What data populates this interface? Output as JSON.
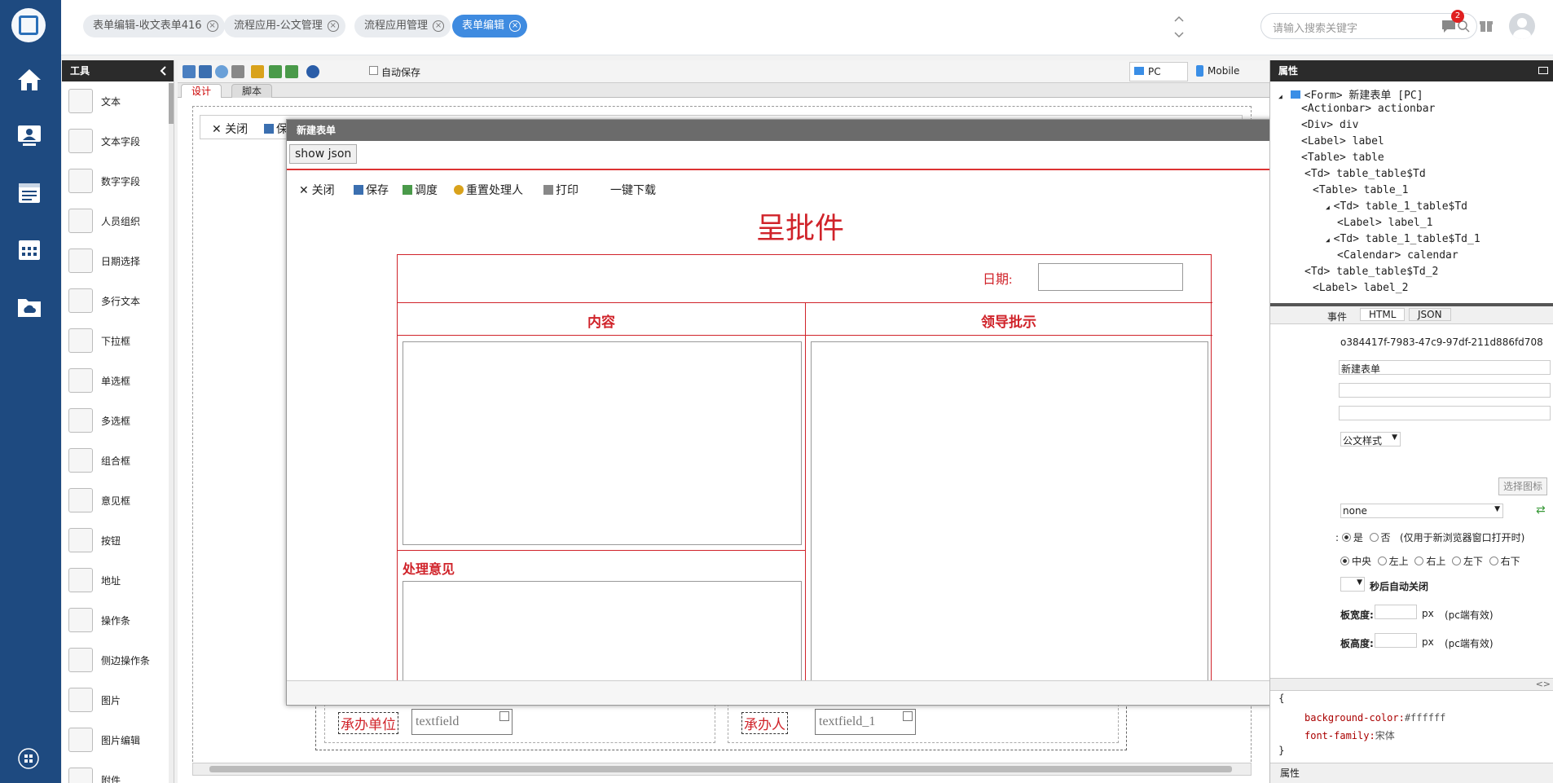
{
  "top_tabs": [
    {
      "label": "表单编辑-收文表单416",
      "active": false
    },
    {
      "label": "流程应用-公文管理",
      "active": false
    },
    {
      "label": "流程应用管理",
      "active": false
    },
    {
      "label": "表单编辑",
      "active": true
    }
  ],
  "search": {
    "placeholder": "请输入搜索关键字"
  },
  "notifications": {
    "count": "2"
  },
  "tools": {
    "title": "工具",
    "items": [
      {
        "label": "文本",
        "icon": "text-icon"
      },
      {
        "label": "文本字段",
        "icon": "textfield-icon"
      },
      {
        "label": "数字字段",
        "icon": "number-field-icon"
      },
      {
        "label": "人员组织",
        "icon": "person-org-icon"
      },
      {
        "label": "日期选择",
        "icon": "calendar-icon"
      },
      {
        "label": "多行文本",
        "icon": "textarea-icon"
      },
      {
        "label": "下拉框",
        "icon": "dropdown-icon"
      },
      {
        "label": "单选框",
        "icon": "radio-icon"
      },
      {
        "label": "多选框",
        "icon": "checkbox-icon"
      },
      {
        "label": "组合框",
        "icon": "combobox-icon"
      },
      {
        "label": "意见框",
        "icon": "opinion-icon"
      },
      {
        "label": "按钮",
        "icon": "hand-pointer-icon"
      },
      {
        "label": "地址",
        "icon": "location-pin-icon"
      },
      {
        "label": "操作条",
        "icon": "actionbar-icon"
      },
      {
        "label": "侧边操作条",
        "icon": "side-actionbar-icon"
      },
      {
        "label": "图片",
        "icon": "image-icon"
      },
      {
        "label": "图片编辑",
        "icon": "image-edit-icon"
      },
      {
        "label": "附件",
        "icon": "attachment-icon"
      }
    ]
  },
  "design_toolbar": {
    "autosave_label": "自动保存",
    "device_pc": "PC",
    "device_mobile": "Mobile"
  },
  "mode_tabs": [
    {
      "label": "设计",
      "active": true
    },
    {
      "label": "脚本",
      "active": false
    }
  ],
  "canvas_bg": {
    "close_label": "关闭",
    "save_label": "保存",
    "unit_label": "承办单位",
    "unit_field": "textfield",
    "person_label": "承办人",
    "person_field": "textfield_1"
  },
  "modal": {
    "title": "新建表单",
    "show_json": "show json",
    "actions": [
      "关闭",
      "保存",
      "调度",
      "重置处理人",
      "打印",
      "一键下载"
    ],
    "form_title": "呈批件",
    "date_label": "日期:",
    "col_content": "内容",
    "col_leader": "领导批示",
    "opinion_label": "处理意见"
  },
  "properties": {
    "title": "属性",
    "tree": [
      "<Form> 新建表单 [PC]",
      "<Actionbar> actionbar",
      "<Div> div",
      "<Label> label",
      "<Table> table",
      "<Td> table_table$Td",
      "<Table> table_1",
      "<Td> table_1_table$Td",
      "<Label> label_1",
      "<Td> table_1_table$Td_1",
      "<Calendar> calendar",
      "<Td> table_table$Td_2",
      "<Label> label_2"
    ],
    "tabs": [
      "事件",
      "HTML",
      "JSON"
    ],
    "id_value": "o384417f-7983-47c9-97df-211d886fd708",
    "name_value": "新建表单",
    "style_select": "公文样式",
    "choose_icon_btn": "选择图标",
    "none_select": "none",
    "new_window_yes": "是",
    "new_window_no": "否",
    "new_window_note": "(仅用于新浏览器窗口打开时)",
    "positions": [
      "中央",
      "左上",
      "右上",
      "左下",
      "右下"
    ],
    "auto_close_label": "秒后自动关闭",
    "width_label": "板宽度:",
    "height_label": "板高度:",
    "px": "px",
    "pc_note": "(pc端有效)",
    "css_lines": [
      {
        "k": "background-color:",
        "v": "#ffffff"
      },
      {
        "k": "font-family:",
        "v": "宋体"
      }
    ],
    "footer": "属性"
  }
}
